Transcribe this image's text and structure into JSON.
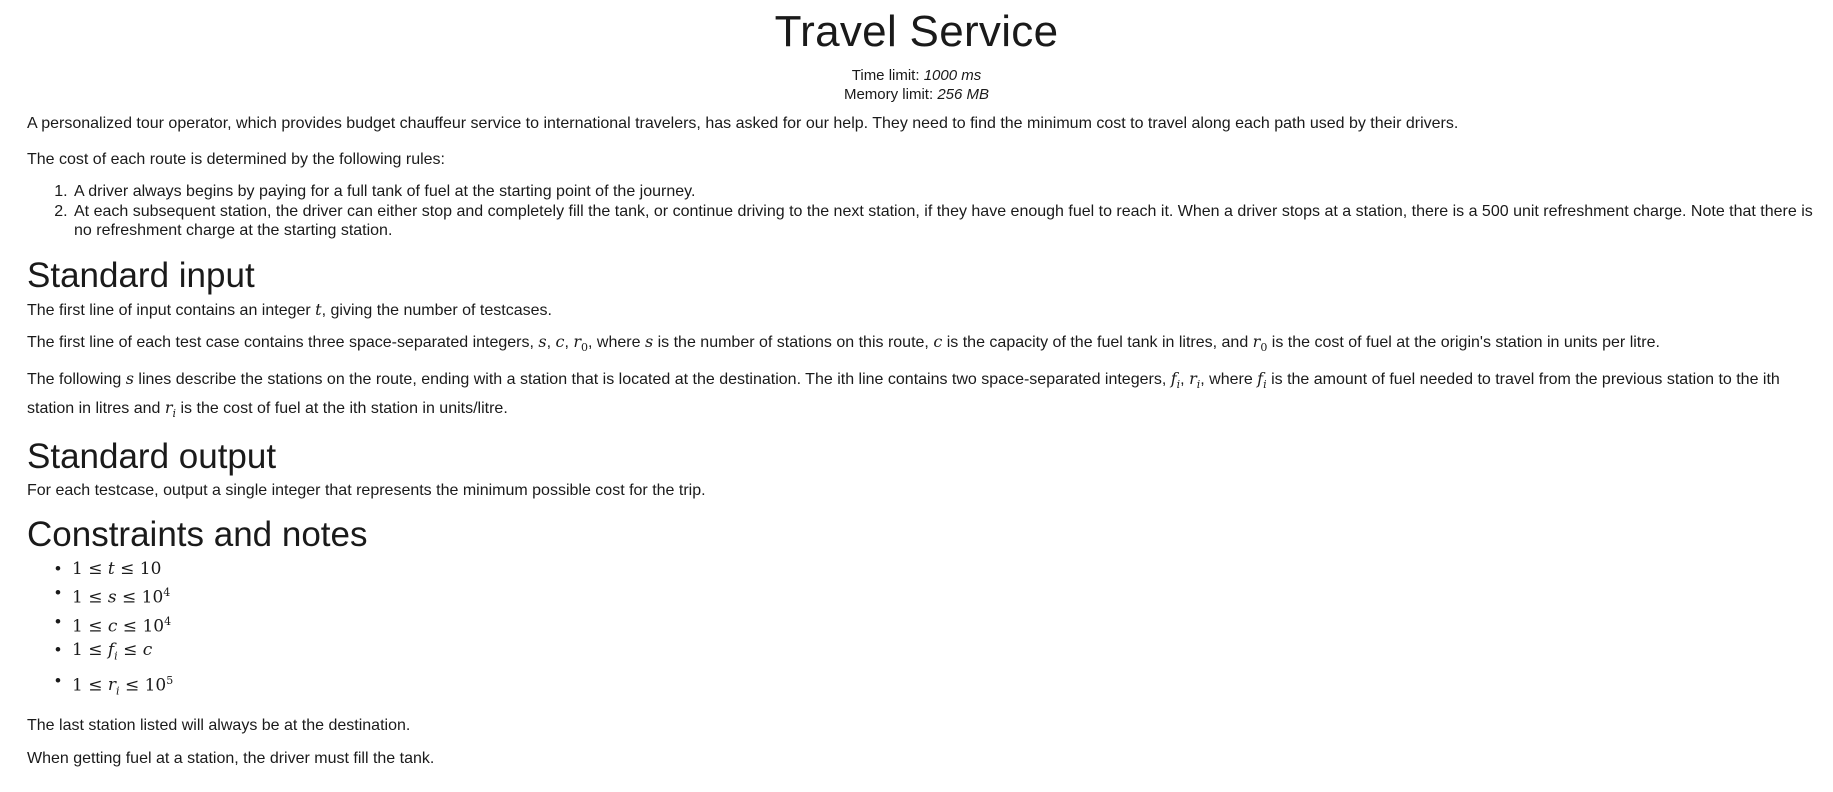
{
  "header": {
    "title": "Travel Service",
    "time_limit_label": "Time limit:",
    "time_limit_value": "1000 ms",
    "memory_limit_label": "Memory limit:",
    "memory_limit_value": "256 MB"
  },
  "statement": {
    "intro": "A personalized tour operator, which provides budget chauffeur service to international travelers, has asked for our help. They need to find the minimum cost to travel along each path used by their drivers.",
    "rules_intro": "The cost of each route is determined by the following rules:",
    "rules": [
      "A driver always begins by paying for a full tank of fuel at the starting point of the journey.",
      "At each subsequent station, the driver can either stop and completely fill the tank, or continue driving to the next station, if they have enough fuel to reach it. When a driver stops at a station, there is a 500 unit refreshment charge. Note that there is no refreshment charge at the starting station."
    ]
  },
  "input_section": {
    "heading": "Standard input",
    "p1_a": "The first line of input contains an integer ",
    "p1_b": ", giving the number of testcases.",
    "p2_a": "The first line of each test case contains three space-separated integers, ",
    "p2_b": ", where ",
    "p2_c": " is the number of stations on this route, ",
    "p2_d": " is the capacity of the fuel tank in litres, and ",
    "p2_e": " is the cost of fuel at the origin's station in units per litre.",
    "p3_a": "The following ",
    "p3_b": " lines describe the stations on the route, ending with a station that is located at the destination. The ith line contains two space-separated integers, ",
    "p3_c": ", where ",
    "p3_d": " is the amount of fuel needed to travel from the previous station to the ith station in litres and ",
    "p3_e": " is the cost of fuel at the ith station in units/litre."
  },
  "output_section": {
    "heading": "Standard output",
    "text": "For each testcase, output a single integer that represents the minimum possible cost for the trip."
  },
  "constraints_section": {
    "heading": "Constraints and notes",
    "note1": "The last station listed will always be at the destination.",
    "note2": "When getting fuel at a station, the driver must fill the tank."
  }
}
